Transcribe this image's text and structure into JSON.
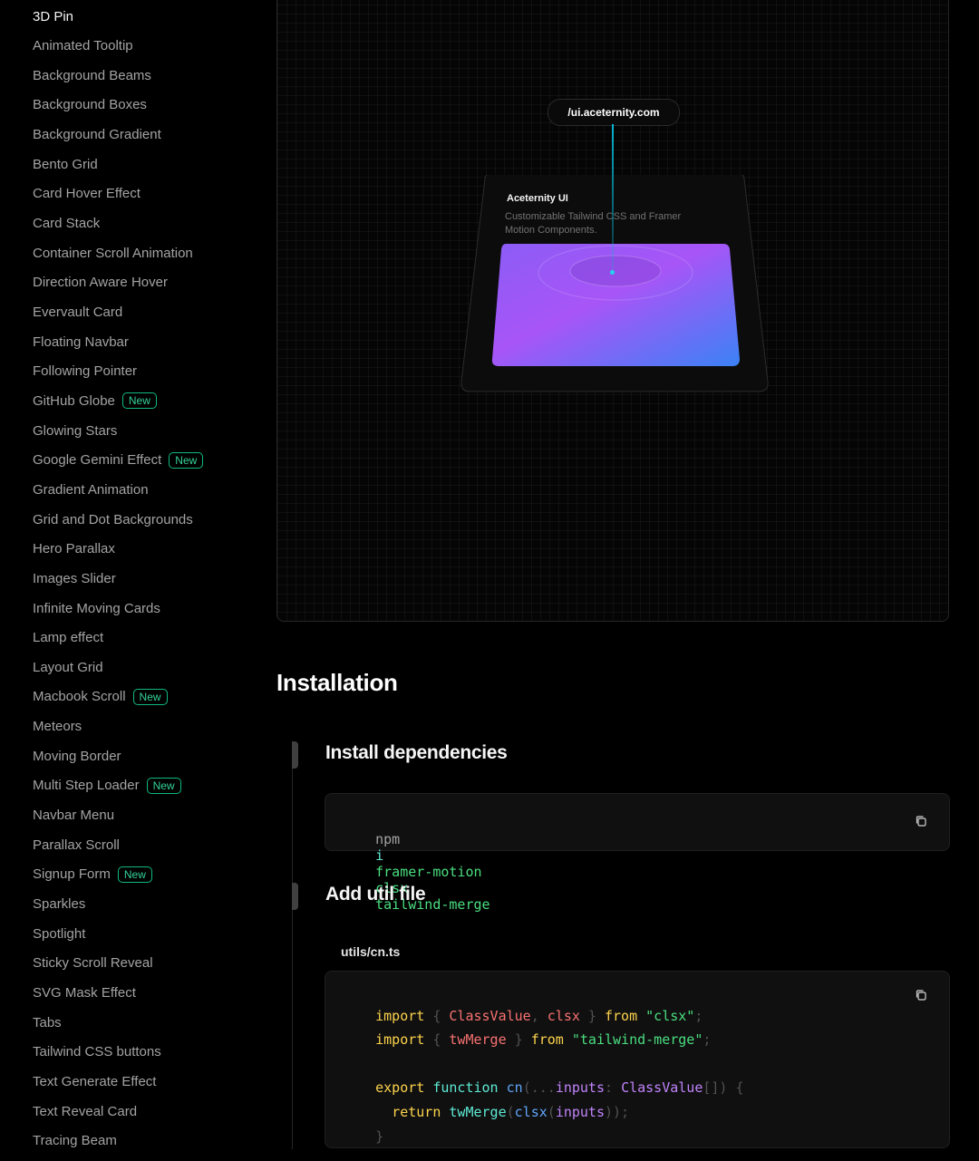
{
  "sidebar": {
    "items": [
      {
        "label": "3D Pin",
        "badge": ""
      },
      {
        "label": "Animated Tooltip",
        "badge": ""
      },
      {
        "label": "Background Beams",
        "badge": ""
      },
      {
        "label": "Background Boxes",
        "badge": ""
      },
      {
        "label": "Background Gradient",
        "badge": ""
      },
      {
        "label": "Bento Grid",
        "badge": ""
      },
      {
        "label": "Card Hover Effect",
        "badge": ""
      },
      {
        "label": "Card Stack",
        "badge": ""
      },
      {
        "label": "Container Scroll Animation",
        "badge": ""
      },
      {
        "label": "Direction Aware Hover",
        "badge": ""
      },
      {
        "label": "Evervault Card",
        "badge": ""
      },
      {
        "label": "Floating Navbar",
        "badge": ""
      },
      {
        "label": "Following Pointer",
        "badge": ""
      },
      {
        "label": "GitHub Globe",
        "badge": "New"
      },
      {
        "label": "Glowing Stars",
        "badge": ""
      },
      {
        "label": "Google Gemini Effect",
        "badge": "New"
      },
      {
        "label": "Gradient Animation",
        "badge": ""
      },
      {
        "label": "Grid and Dot Backgrounds",
        "badge": ""
      },
      {
        "label": "Hero Parallax",
        "badge": ""
      },
      {
        "label": "Images Slider",
        "badge": ""
      },
      {
        "label": "Infinite Moving Cards",
        "badge": ""
      },
      {
        "label": "Lamp effect",
        "badge": ""
      },
      {
        "label": "Layout Grid",
        "badge": ""
      },
      {
        "label": "Macbook Scroll",
        "badge": "New"
      },
      {
        "label": "Meteors",
        "badge": ""
      },
      {
        "label": "Moving Border",
        "badge": ""
      },
      {
        "label": "Multi Step Loader",
        "badge": "New"
      },
      {
        "label": "Navbar Menu",
        "badge": ""
      },
      {
        "label": "Parallax Scroll",
        "badge": ""
      },
      {
        "label": "Signup Form",
        "badge": "New"
      },
      {
        "label": "Sparkles",
        "badge": ""
      },
      {
        "label": "Spotlight",
        "badge": ""
      },
      {
        "label": "Sticky Scroll Reveal",
        "badge": ""
      },
      {
        "label": "SVG Mask Effect",
        "badge": ""
      },
      {
        "label": "Tabs",
        "badge": ""
      },
      {
        "label": "Tailwind CSS buttons",
        "badge": ""
      },
      {
        "label": "Text Generate Effect",
        "badge": ""
      },
      {
        "label": "Text Reveal Card",
        "badge": ""
      },
      {
        "label": "Tracing Beam",
        "badge": ""
      }
    ]
  },
  "preview": {
    "pin_title": "/ui.aceternity.com",
    "card_title": "Aceternity UI",
    "card_desc_1": "Customizable Tailwind CSS and Framer",
    "card_desc_2": "Motion Components."
  },
  "installation": {
    "title": "Installation",
    "step1_title": "Install dependencies",
    "step1_cmd": [
      "npm",
      "i",
      "framer-motion",
      "clsx",
      "tailwind-merge"
    ],
    "step2_title": "Add util file",
    "step2_filename": "utils/cn.ts",
    "code": {
      "l1": [
        "import",
        " { ",
        "ClassValue",
        ", ",
        "clsx",
        " } ",
        "from",
        " ",
        "\"clsx\"",
        ";"
      ],
      "l2": [
        "import",
        " { ",
        "twMerge",
        " } ",
        "from",
        " ",
        "\"tailwind-merge\"",
        ";"
      ],
      "l4": [
        "export",
        " ",
        "function",
        " ",
        "cn",
        "(...",
        "inputs",
        ": ",
        "ClassValue",
        "[]) {"
      ],
      "l5": [
        "  ",
        "return",
        " ",
        "twMerge",
        "(",
        "clsx",
        "(",
        "inputs",
        "));"
      ],
      "l6": [
        "}"
      ]
    }
  },
  "colors": {
    "accent_badge": "#34d399",
    "pin_beam": "#06b6d4",
    "gradient_start": "#a855f7",
    "gradient_end": "#3b82f6"
  }
}
